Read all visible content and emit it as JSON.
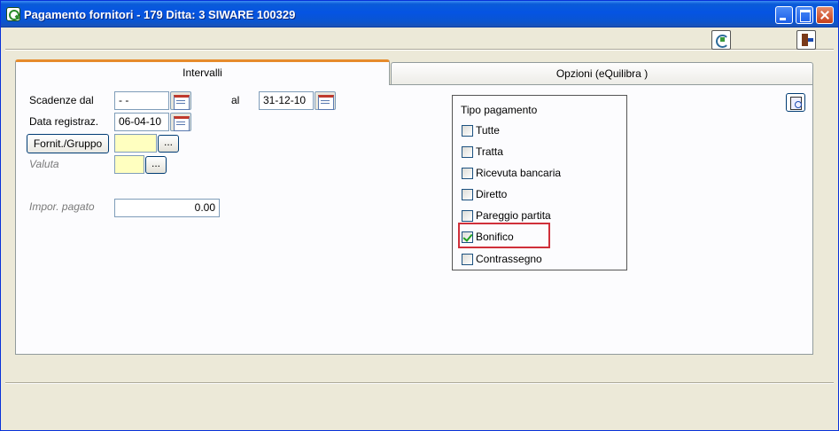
{
  "window": {
    "title": "Pagamento fornitori - 179    Ditta: 3  SIWARE 100329",
    "accent": "#0554e3"
  },
  "tabs": [
    {
      "label": "Intervalli",
      "active": true
    },
    {
      "label": "Opzioni (eQuilibra )",
      "active": false
    }
  ],
  "form": {
    "scadenze_label": "Scadenze dal",
    "scadenze_from": " - -",
    "al_label": "al",
    "scadenze_to": "31-12-10",
    "data_reg_label": "Data registraz.",
    "data_reg_value": "06-04-10",
    "fornit_button": "Fornit./Gruppo",
    "fornit_value": "",
    "ellipsis": "...",
    "valuta_label": "Valuta",
    "valuta_value": "",
    "impor_label": "Impor. pagato",
    "impor_value": "0.00"
  },
  "tipo_pagamento": {
    "title": "Tipo pagamento",
    "options": [
      {
        "label": "Tutte",
        "checked": false
      },
      {
        "label": "Tratta",
        "checked": false
      },
      {
        "label": "Ricevuta bancaria",
        "checked": false
      },
      {
        "label": "Diretto",
        "checked": false
      },
      {
        "label": "Pareggio partita",
        "checked": false
      },
      {
        "label": "Bonifico",
        "checked": true
      },
      {
        "label": "Contrassegno",
        "checked": false
      }
    ],
    "highlight_color": "#d0303a"
  },
  "icons": {
    "toolbar": [
      "refresh-icon",
      "exit-icon"
    ],
    "field_button": "calendar-icon",
    "preview": "preview-icon"
  }
}
